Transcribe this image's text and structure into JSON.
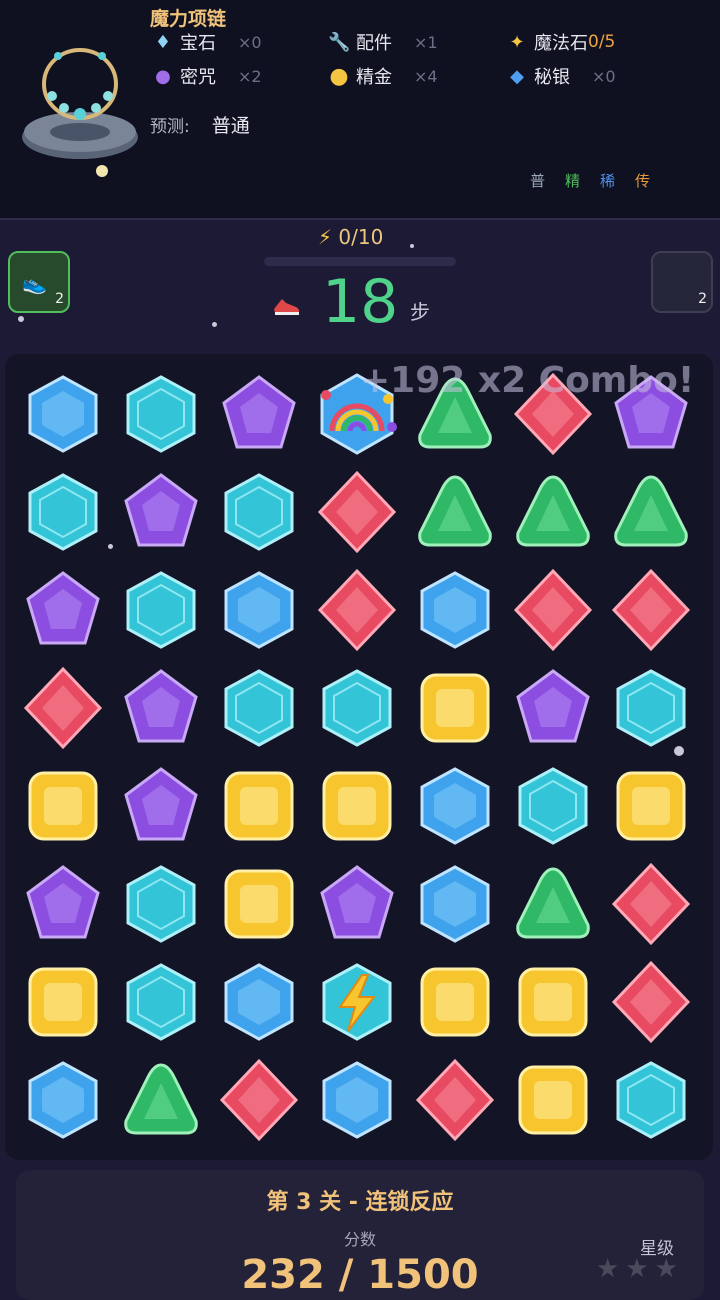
{
  "item": {
    "title": "魔力项链"
  },
  "materials": [
    {
      "icon": "diamond-icon",
      "name": "宝石",
      "count": "×0"
    },
    {
      "icon": "wrench-icon",
      "name": "配件",
      "count": "×1"
    },
    {
      "icon": "sparkle-icon",
      "name": "魔法石",
      "count": "0/5"
    },
    {
      "icon": "crystal-ball-icon",
      "name": "密咒",
      "count": "×2"
    },
    {
      "icon": "gold-coin-icon",
      "name": "精金",
      "count": "×4"
    },
    {
      "icon": "blue-diamond-icon",
      "name": "秘银",
      "count": "×0"
    }
  ],
  "prediction": {
    "label": "预测:",
    "value": "普通"
  },
  "rarity": [
    {
      "label": "普",
      "color": "#9aa6b8"
    },
    {
      "label": "精",
      "color": "#4fbe5b"
    },
    {
      "label": "稀",
      "color": "#4f8fe8"
    },
    {
      "label": "传",
      "color": "#e89a3c"
    }
  ],
  "energy": {
    "text": "0/10",
    "icon": "lightning-icon",
    "level": 0
  },
  "tools": {
    "left_badge": "2",
    "right_badge": "2"
  },
  "steps": {
    "value": "18",
    "unit": "步",
    "icon": "shoe-icon"
  },
  "combo_text": "+192 x2 Combo!",
  "board": {
    "rows": [
      [
        "blue",
        "cyan",
        "purple",
        "rainbow",
        "green",
        "red",
        "purple"
      ],
      [
        "cyan",
        "purple",
        "cyan",
        "red",
        "green",
        "green",
        "green"
      ],
      [
        "purple",
        "cyan",
        "blue",
        "red",
        "blue",
        "red",
        "red"
      ],
      [
        "red",
        "purple",
        "cyan",
        "cyan",
        "yellow",
        "purple",
        "cyan"
      ],
      [
        "yellow",
        "purple",
        "yellow",
        "yellow",
        "blue",
        "cyan",
        "yellow"
      ],
      [
        "purple",
        "cyan",
        "yellow",
        "purple",
        "blue",
        "green",
        "red"
      ],
      [
        "yellow",
        "cyan",
        "blue",
        "lightning",
        "yellow",
        "yellow",
        "red"
      ],
      [
        "blue",
        "green",
        "red",
        "blue",
        "red",
        "yellow",
        "cyan"
      ]
    ]
  },
  "gem_colors": {
    "blue": "#3ea2ec",
    "cyan": "#33c4d8",
    "purple": "#8c4ee0",
    "red": "#e84a62",
    "green": "#2fb866",
    "yellow": "#f7c62e"
  },
  "level": {
    "title": "第 3 关 - 连锁反应",
    "score_label": "分数",
    "score": "232 / 1500"
  },
  "stars": {
    "label": "星级",
    "symbols": "★★★",
    "earned": 0
  }
}
